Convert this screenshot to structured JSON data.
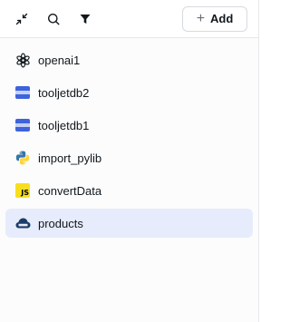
{
  "toolbar": {
    "icons": [
      "collapse-icon",
      "search-icon",
      "filter-icon"
    ],
    "add_label": "Add"
  },
  "queries": [
    {
      "name": "openai1",
      "icon": "openai-icon",
      "active": false
    },
    {
      "name": "tooljetdb2",
      "icon": "tooljetdb-icon",
      "active": false
    },
    {
      "name": "tooljetdb1",
      "icon": "tooljetdb-icon",
      "active": false
    },
    {
      "name": "import_pylib",
      "icon": "python-icon",
      "active": false
    },
    {
      "name": "convertData",
      "icon": "javascript-icon",
      "active": false
    },
    {
      "name": "products",
      "icon": "restapi-cloud-icon",
      "active": true
    }
  ],
  "icon_badges": {
    "javascript": "JS"
  },
  "colors": {
    "active_bg": "#e6ecfb",
    "tooljetdb": "#3e63dd",
    "python_blue": "#3776ab",
    "python_yellow": "#ffd43b",
    "js_yellow": "#f7df1e",
    "cloud": "#1c3b6a"
  }
}
